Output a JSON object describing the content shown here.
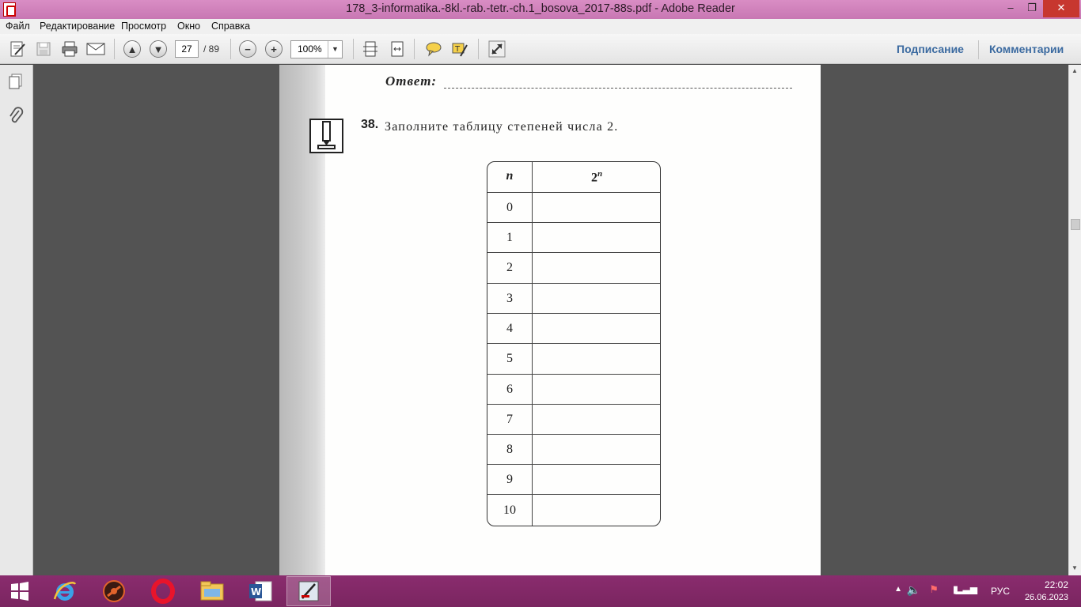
{
  "window": {
    "title": "178_3-informatika.-8kl.-rab.-tetr.-ch.1_bosova_2017-88s.pdf - Adobe Reader",
    "min_label": "–",
    "max_label": "❐",
    "close_label": "✕"
  },
  "menu": {
    "items": [
      "Файл",
      "Редактирование",
      "Просмотр",
      "Окно",
      "Справка"
    ]
  },
  "toolbar": {
    "page_current": "27",
    "page_total": "/ 89",
    "zoom": "100%",
    "sign_label": "Подписание",
    "comment_label": "Комментарии"
  },
  "document": {
    "answer_label": "Ответ:",
    "task_number": "38.",
    "task_text": "Заполните таблицу степеней числа 2.",
    "table": {
      "header_n": "n",
      "header_pow_base": "2",
      "header_pow_exp": "n",
      "rows": [
        "0",
        "1",
        "2",
        "3",
        "4",
        "5",
        "6",
        "7",
        "8",
        "9",
        "10"
      ]
    }
  },
  "taskbar": {
    "apps": [
      "start-icon",
      "internet-explorer-icon",
      "media-player-icon",
      "opera-icon",
      "file-explorer-icon",
      "word-icon",
      "adobe-reader-icon"
    ],
    "tray_lang": "РУС",
    "time": "22:02",
    "date": "26.06.2023"
  }
}
